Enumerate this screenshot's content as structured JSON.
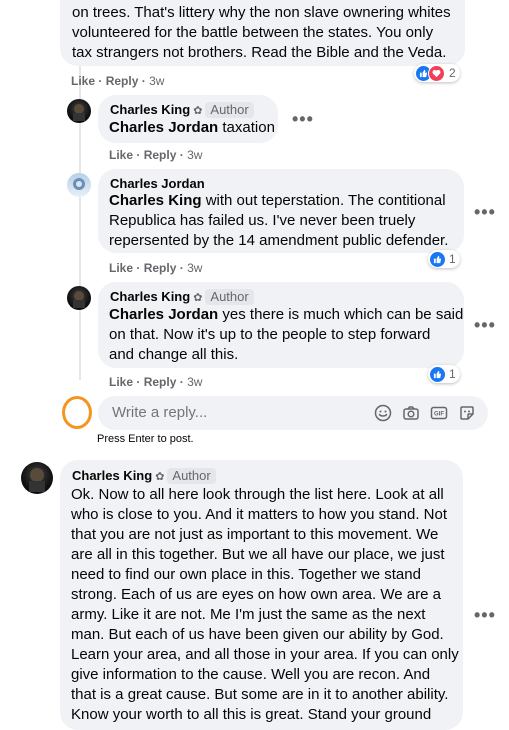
{
  "top_comment": {
    "lines": [
      "on trees. That's littery why the non slave ownering whites",
      "volunteered for the battle between the states. You only",
      "tax strangers not brothers. Read the Bible and the Veda."
    ],
    "like_label": "Like",
    "reply_label": "Reply",
    "time": "3w",
    "reaction_count": "2"
  },
  "replies": [
    {
      "author": "Charles King",
      "badge": "Author",
      "mention": "Charles Jordan",
      "lines": [
        " taxation"
      ],
      "like_label": "Like",
      "reply_label": "Reply",
      "time": "3w"
    },
    {
      "author": "Charles Jordan",
      "mention": "Charles King",
      "lines": [
        " with out teperstation. The contitional",
        "Republica has failed us. I've never been truely",
        "repersented by the 14 amendment public defender."
      ],
      "like_label": "Like",
      "reply_label": "Reply",
      "time": "3w",
      "reaction_count": "1"
    },
    {
      "author": "Charles King",
      "badge": "Author",
      "mention": "Charles Jordan",
      "lines": [
        " yes there is much which can be said",
        "on that. Now it's up to the people to step forward",
        "and change all this."
      ],
      "like_label": "Like",
      "reply_label": "Reply",
      "time": "3w",
      "reaction_count": "1"
    }
  ],
  "reply_box": {
    "placeholder": "Write a reply...",
    "hint": "Press Enter to post.",
    "tools": [
      "emoji-icon",
      "camera-icon",
      "gif-icon",
      "sticker-icon"
    ]
  },
  "bottom_comment": {
    "author": "Charles King",
    "badge": "Author",
    "lines": [
      "Ok. Now to all here look through the list here. Look at all",
      "who is close to you. And it matters to how you stand. Not",
      "that you are not just as important to this movement. We",
      "are all in this together. But we all have our place, we just",
      "need to find our own place in this. Together we stand",
      "strong. Each of us are eyes on how own area. We are a",
      "army. Like it are not. Me I'm just the same as the next",
      "man. But each of us have been given our ability by God.",
      "Learn your area, and all those in your area. If you can only",
      "give information to the cause. Well you are recon. And",
      "that is a great cause. But some are in it to another ability.",
      "Know your worth to all this is great. Stand your ground"
    ]
  },
  "colors": {
    "bubble": "#f0f2f5",
    "meta_text": "#65676b",
    "like_blue": "#1877f2",
    "love_red": "#f33e58",
    "highlight_circle": "#f7941d"
  }
}
